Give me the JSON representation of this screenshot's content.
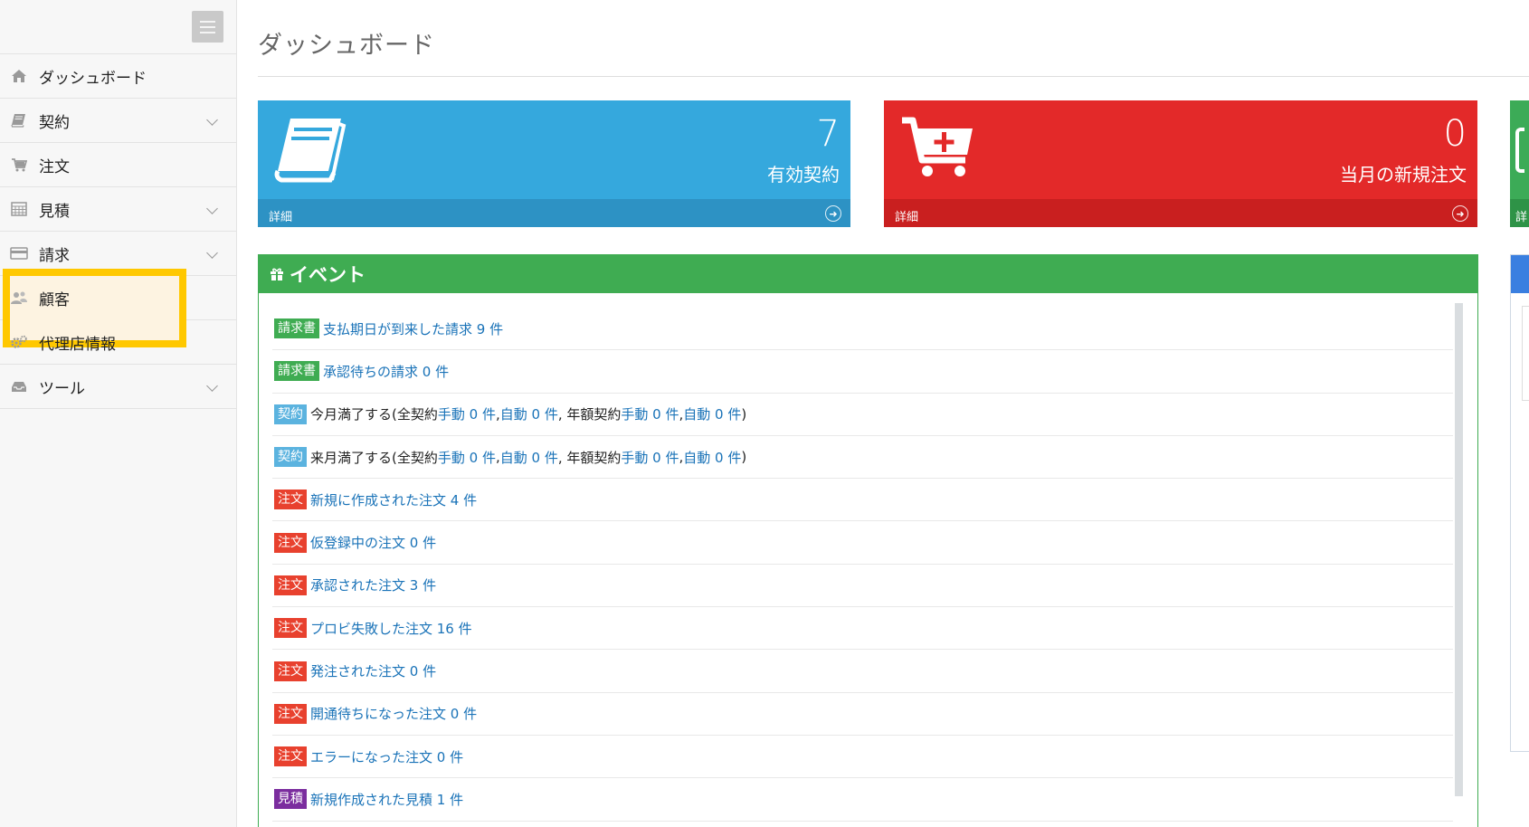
{
  "sidebar": {
    "items": [
      {
        "label": "ダッシュボード",
        "icon": "home-icon",
        "chevron": false
      },
      {
        "label": "契約",
        "icon": "book-icon",
        "chevron": true
      },
      {
        "label": "注文",
        "icon": "cart-icon",
        "chevron": false
      },
      {
        "label": "見積",
        "icon": "calculator-icon",
        "chevron": true
      },
      {
        "label": "請求",
        "icon": "credit-card-icon",
        "chevron": true
      },
      {
        "label": "顧客",
        "icon": "users-icon",
        "chevron": false,
        "highlighted": true
      },
      {
        "label": "代理店情報",
        "icon": "gears-icon",
        "chevron": false
      },
      {
        "label": "ツール",
        "icon": "inbox-icon",
        "chevron": true
      }
    ]
  },
  "main": {
    "title": "ダッシュボード",
    "stats": [
      {
        "value": "7",
        "label": "有効契約",
        "footer": "詳細",
        "color": "#35a8dd",
        "icon": "book-icon"
      },
      {
        "value": "0",
        "label": "当月の新規注文",
        "footer": "詳細",
        "color": "#e32929",
        "icon": "cart-plus-icon"
      },
      {
        "footer": "詳",
        "color": "#3cab57"
      }
    ],
    "events": {
      "title": "イベント",
      "rows": [
        {
          "tag": "請求書",
          "tag_color": "#3fac52",
          "parts": [
            {
              "t": "支払期日が到来した請求 9 件",
              "link": true
            }
          ]
        },
        {
          "tag": "請求書",
          "tag_color": "#3fac52",
          "parts": [
            {
              "t": "承認待ちの請求 0 件",
              "link": true
            }
          ]
        },
        {
          "tag": "契約",
          "tag_color": "#5bb3df",
          "parts": [
            {
              "t": "今月満了する(全契約 ",
              "link": false
            },
            {
              "t": "手動 0 件",
              "link": true
            },
            {
              "t": ", ",
              "link": false
            },
            {
              "t": "自動 0 件",
              "link": true
            },
            {
              "t": ", 年額契約 ",
              "link": false
            },
            {
              "t": "手動 0 件",
              "link": true
            },
            {
              "t": ", ",
              "link": false
            },
            {
              "t": "自動 0 件",
              "link": true
            },
            {
              "t": ")",
              "link": false
            }
          ]
        },
        {
          "tag": "契約",
          "tag_color": "#5bb3df",
          "parts": [
            {
              "t": "来月満了する(全契約 ",
              "link": false
            },
            {
              "t": "手動 0 件",
              "link": true
            },
            {
              "t": ", ",
              "link": false
            },
            {
              "t": "自動 0 件",
              "link": true
            },
            {
              "t": ", 年額契約 ",
              "link": false
            },
            {
              "t": "手動 0 件",
              "link": true
            },
            {
              "t": ", ",
              "link": false
            },
            {
              "t": "自動 0 件",
              "link": true
            },
            {
              "t": ")",
              "link": false
            }
          ]
        },
        {
          "tag": "注文",
          "tag_color": "#e8412e",
          "parts": [
            {
              "t": "新規に作成された注文 4 件",
              "link": true
            }
          ]
        },
        {
          "tag": "注文",
          "tag_color": "#e8412e",
          "parts": [
            {
              "t": "仮登録中の注文 0 件",
              "link": true
            }
          ]
        },
        {
          "tag": "注文",
          "tag_color": "#e8412e",
          "parts": [
            {
              "t": "承認された注文 3 件",
              "link": true
            }
          ]
        },
        {
          "tag": "注文",
          "tag_color": "#e8412e",
          "parts": [
            {
              "t": "プロビ失敗した注文 16 件",
              "link": true
            }
          ]
        },
        {
          "tag": "注文",
          "tag_color": "#e8412e",
          "parts": [
            {
              "t": "発注された注文 0 件",
              "link": true
            }
          ]
        },
        {
          "tag": "注文",
          "tag_color": "#e8412e",
          "parts": [
            {
              "t": "開通待ちになった注文 0 件",
              "link": true
            }
          ]
        },
        {
          "tag": "注文",
          "tag_color": "#e8412e",
          "parts": [
            {
              "t": "エラーになった注文 0 件",
              "link": true
            }
          ]
        },
        {
          "tag": "見積",
          "tag_color": "#7b2d9e",
          "parts": [
            {
              "t": "新規作成された見積 1 件",
              "link": true
            }
          ]
        }
      ]
    }
  },
  "colors": {
    "highlight": "#ffc800",
    "link": "#1a73b8",
    "events_header": "#3fac52"
  }
}
